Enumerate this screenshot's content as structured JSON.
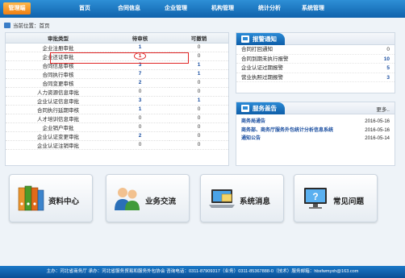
{
  "nav": {
    "items": [
      {
        "label": "管理端",
        "active": true
      },
      {
        "label": "首页"
      },
      {
        "label": "合同信息"
      },
      {
        "label": "企业管理"
      },
      {
        "label": "机构管理"
      },
      {
        "label": "统计分析"
      },
      {
        "label": "系统管理"
      }
    ]
  },
  "breadcrumb": "当前位置：首页",
  "audit_table": {
    "headers": [
      "审批类型",
      "待审核",
      "可撤销"
    ],
    "rows": [
      {
        "type": "企业注册审批",
        "pending": "1",
        "revocable": "0"
      },
      {
        "type": "企业还证审批",
        "pending": "1",
        "revocable": "0"
      },
      {
        "type": "合同信息审核",
        "pending": "3",
        "revocable": "1"
      },
      {
        "type": "合同执行审核",
        "pending": "7",
        "revocable": "1"
      },
      {
        "type": "合同变更审核",
        "pending": "2",
        "revocable": "0"
      },
      {
        "type": "人力资源信息审批",
        "pending": "0",
        "revocable": "0"
      },
      {
        "type": "企业认证信息审批",
        "pending": "3",
        "revocable": "1"
      },
      {
        "type": "合同执行延期审核",
        "pending": "1",
        "revocable": "0"
      },
      {
        "type": "人才培训信息审批",
        "pending": "0",
        "revocable": "0"
      },
      {
        "type": "企业销户审批",
        "pending": "0",
        "revocable": "0"
      },
      {
        "type": "企业认证变更审批",
        "pending": "2",
        "revocable": "0"
      },
      {
        "type": "企业认证注销审批",
        "pending": "0",
        "revocable": "0"
      }
    ]
  },
  "alerts": {
    "title": "报警通知",
    "items": [
      {
        "label": "合同打回通知",
        "value": "0"
      },
      {
        "label": "合同到期未执行报警",
        "value": "10"
      },
      {
        "label": "企业认证过期报警",
        "value": "5"
      },
      {
        "label": "营业执照过期报警",
        "value": "3"
      }
    ]
  },
  "notices": {
    "title": "服务盖告",
    "more": "更多..",
    "items": [
      {
        "title": "商务局通告",
        "date": "2016-05-16"
      },
      {
        "title": "商务部、商务厅服务外包统计分析信息系统",
        "date": "2016-05-16"
      },
      {
        "title": "通知公告",
        "date": "2016-05-14"
      }
    ]
  },
  "tiles": [
    {
      "label": "资料中心",
      "icon": "binders-icon"
    },
    {
      "label": "业务交流",
      "icon": "people-icon"
    },
    {
      "label": "系统消息",
      "icon": "laptop-icon"
    },
    {
      "label": "常见问题",
      "icon": "monitor-help-icon"
    }
  ],
  "footer": "主办：河北省商务厅 承办：河北省服务贸易和服务外包协会 咨询电话：0311-87909317（业务）0311-85367888-0（技术）服务邮箱：hbsfwmyxh@163.com",
  "colors": {
    "nav_blue": "#0f62ac",
    "active_orange": "#f07f12",
    "value_blue": "#1a4ea0",
    "highlight_red": "#e02424"
  }
}
